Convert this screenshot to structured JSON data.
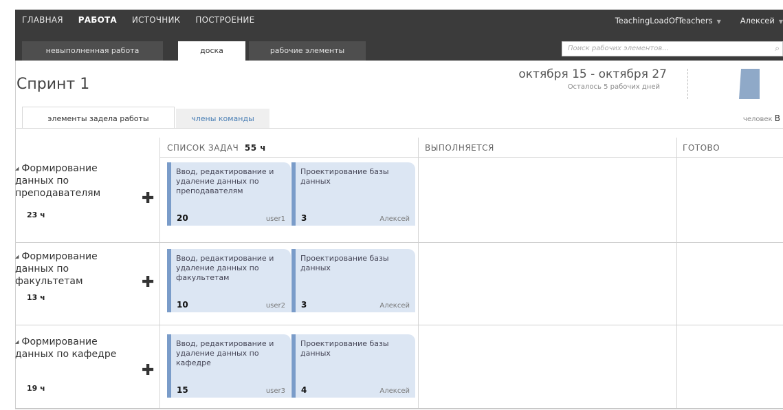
{
  "topnav": {
    "items": [
      "ГЛАВНАЯ",
      "РАБОТА",
      "ИСТОЧНИК",
      "ПОСТРОЕНИЕ"
    ],
    "project": "TeachingLoadOfTeachers",
    "user": "Алексей"
  },
  "subnav": {
    "tabs": [
      "невыполненная работа",
      "доска",
      "рабочие элементы"
    ],
    "search_placeholder": "Поиск рабочих элементов..."
  },
  "sprint": {
    "title": "Спринт 1",
    "dates": "октября 15 - октября 27",
    "remaining": "Осталось 5 рабочих дней"
  },
  "tabs": {
    "backlog_items": "элементы задела работы",
    "team_members": "члены команды",
    "person_label": "человек",
    "person_value": "В"
  },
  "columns": {
    "todo": "СПИСОК ЗАДАЧ",
    "todo_hours": "55 ч",
    "in_progress": "ВЫПОЛНЯЕТСЯ",
    "done": "ГОТОВО"
  },
  "rows": [
    {
      "title": "Формирование данных по преподавателям",
      "hours": "23 ч",
      "cards": [
        {
          "title": "Ввод, редактирование и удаление данных по преподавателям",
          "hours": "20",
          "user": "user1"
        },
        {
          "title": "Проектирование базы данных",
          "hours": "3",
          "user": "Алексей"
        }
      ]
    },
    {
      "title": "Формирование данных по факультетам",
      "hours": "13 ч",
      "cards": [
        {
          "title": "Ввод, редактирование и удаление данных по факультетам",
          "hours": "10",
          "user": "user2"
        },
        {
          "title": "Проектирование базы данных",
          "hours": "3",
          "user": "Алексей"
        }
      ]
    },
    {
      "title": "Формирование данных по кафедре",
      "hours": "19 ч",
      "cards": [
        {
          "title": "Ввод, редактирование и удаление данных по кафедре",
          "hours": "15",
          "user": "user3"
        },
        {
          "title": "Проектирование базы данных",
          "hours": "4",
          "user": "Алексей"
        }
      ]
    }
  ],
  "colors": {
    "nav_bg": "#3b3b3b",
    "card_bg": "#dce6f3",
    "card_accent": "#7a9cc9",
    "link": "#4a7fb5"
  }
}
